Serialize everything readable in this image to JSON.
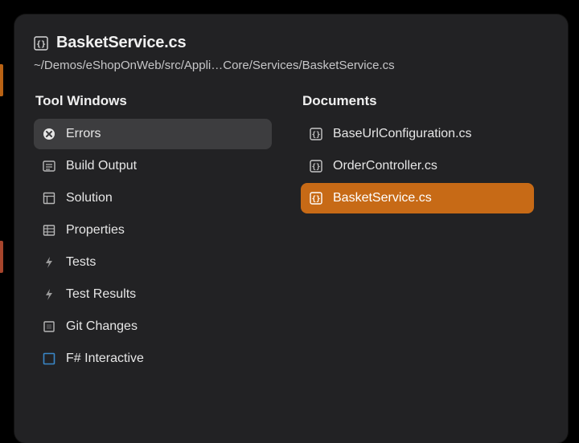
{
  "header": {
    "icon": "cs-file-icon",
    "title": "BasketService.cs",
    "path": "~/Demos/eShopOnWeb/src/Appli…Core/Services/BasketService.cs"
  },
  "columns": {
    "tool_windows": {
      "title": "Tool Windows",
      "items": [
        {
          "icon": "error-circle-icon",
          "label": "Errors",
          "hover": true
        },
        {
          "icon": "output-icon",
          "label": "Build Output"
        },
        {
          "icon": "solution-icon",
          "label": "Solution"
        },
        {
          "icon": "properties-icon",
          "label": "Properties"
        },
        {
          "icon": "bolt-icon",
          "label": "Tests"
        },
        {
          "icon": "bolt-icon",
          "label": "Test Results"
        },
        {
          "icon": "git-icon",
          "label": "Git Changes"
        },
        {
          "icon": "fsharp-icon",
          "label": "F# Interactive"
        }
      ]
    },
    "documents": {
      "title": "Documents",
      "items": [
        {
          "icon": "cs-file-icon",
          "label": "BaseUrlConfiguration.cs"
        },
        {
          "icon": "cs-file-icon",
          "label": "OrderController.cs"
        },
        {
          "icon": "cs-file-icon",
          "label": "BasketService.cs",
          "selected": true
        }
      ]
    }
  }
}
